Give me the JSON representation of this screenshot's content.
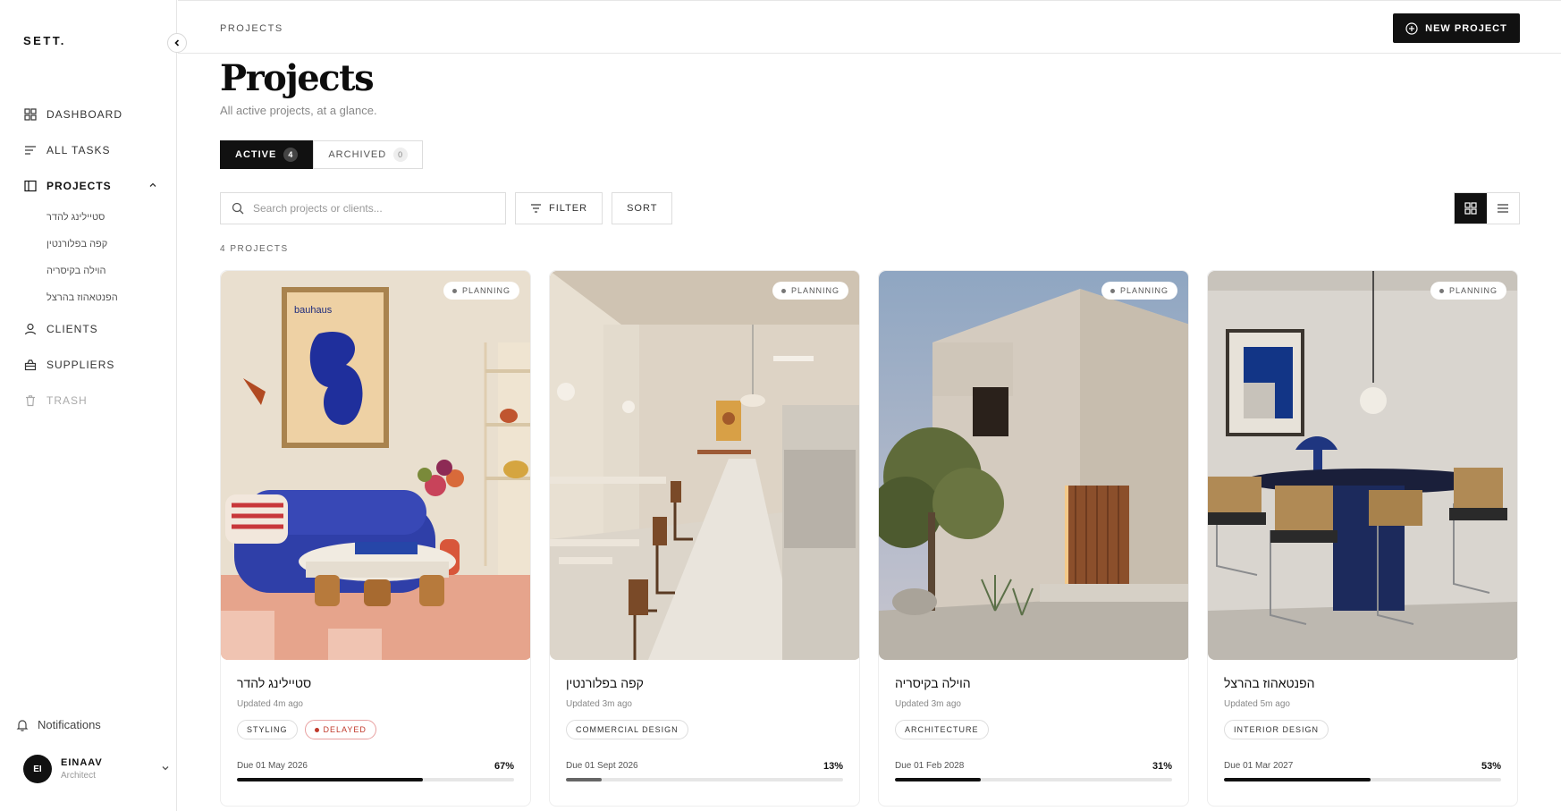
{
  "app": {
    "logo": "SETT."
  },
  "sidebar": {
    "items": [
      {
        "label": "DASHBOARD",
        "icon": "grid-icon"
      },
      {
        "label": "ALL TASKS",
        "icon": "list-icon"
      },
      {
        "label": "PROJECTS",
        "icon": "layout-icon",
        "active": true
      },
      {
        "label": "CLIENTS",
        "icon": "user-icon"
      },
      {
        "label": "SUPPLIERS",
        "icon": "basket-icon"
      },
      {
        "label": "TRASH",
        "icon": "trash-icon"
      }
    ],
    "projects": [
      "סטיילינג להדר",
      "קפה בפלורנטין",
      "הוילה בקיסריה",
      "הפנטאהוז בהרצל"
    ],
    "notifications": "Notifications",
    "user": {
      "initials": "EI",
      "name": "EINAAV",
      "role": "Architect"
    }
  },
  "header": {
    "breadcrumb": "PROJECTS",
    "new_project": "NEW PROJECT"
  },
  "page": {
    "title": "Projects",
    "subtitle": "All active projects, at a glance."
  },
  "tabs": [
    {
      "label": "ACTIVE",
      "count": "4"
    },
    {
      "label": "ARCHIVED",
      "count": "0"
    }
  ],
  "toolbar": {
    "search_placeholder": "Search projects or clients...",
    "filter": "FILTER",
    "sort": "SORT"
  },
  "projects_count": "4 PROJECTS",
  "cards": [
    {
      "title": "סטיילינג להדר",
      "updated": "Updated 4m ago",
      "status": "PLANNING",
      "tags": [
        "STYLING"
      ],
      "delayed": "DELAYED",
      "due": "Due 01 May 2026",
      "progress": "67%",
      "progress_value": 0.67
    },
    {
      "title": "קפה בפלורנטין",
      "updated": "Updated 3m ago",
      "status": "PLANNING",
      "tags": [
        "COMMERCIAL DESIGN"
      ],
      "due": "Due 01 Sept 2026",
      "progress": "13%",
      "progress_value": 0.13
    },
    {
      "title": "הוילה בקיסריה",
      "updated": "Updated 3m ago",
      "status": "PLANNING",
      "tags": [
        "ARCHITECTURE"
      ],
      "due": "Due 01 Feb 2028",
      "progress": "31%",
      "progress_value": 0.31
    },
    {
      "title": "הפנטאהוז בהרצל",
      "updated": "Updated 5m ago",
      "status": "PLANNING",
      "tags": [
        "INTERIOR DESIGN"
      ],
      "due": "Due 01 Mar 2027",
      "progress": "53%",
      "progress_value": 0.53
    }
  ]
}
